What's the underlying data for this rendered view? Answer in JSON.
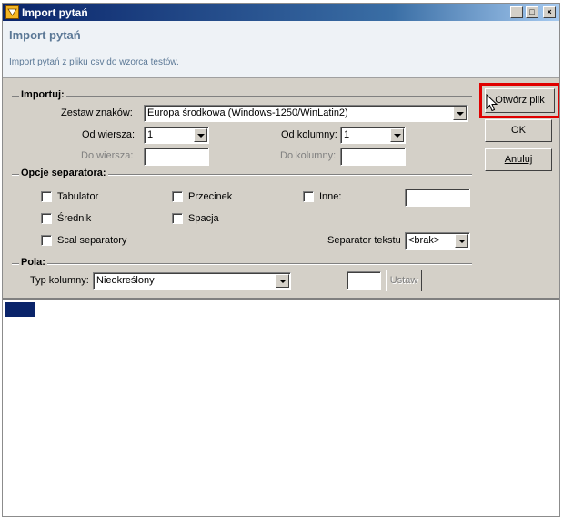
{
  "window": {
    "title": "Import pytań",
    "min": "_",
    "max": "□",
    "close": "×"
  },
  "header": {
    "title": "Import pytań",
    "description": "Import pytań z pliku csv do wzorca testów."
  },
  "import_group": {
    "label": "Importuj:",
    "charset_label": "Zestaw znaków:",
    "charset_value": "Europa środkowa (Windows-1250/WinLatin2)",
    "from_row_label": "Od wiersza:",
    "from_row_value": "1",
    "to_row_label": "Do wiersza:",
    "from_col_label": "Od kolumny:",
    "from_col_value": "1",
    "to_col_label": "Do kolumny:"
  },
  "separator_group": {
    "label": "Opcje separatora:",
    "tab": "Tabulator",
    "comma": "Przecinek",
    "other": "Inne:",
    "semicolon": "Średnik",
    "space": "Spacja",
    "merge": "Scal separatory",
    "text_sep_label": "Separator tekstu",
    "text_sep_value": "<brak>"
  },
  "fields_group": {
    "label": "Pola:",
    "col_type_label": "Typ kolumny:",
    "col_type_value": "Nieokreślony",
    "set_button": "Ustaw"
  },
  "buttons": {
    "open": "Otwórz plik",
    "ok": "OK",
    "cancel": "Anuluj"
  },
  "colors": {
    "title_start": "#0a246a",
    "title_end": "#a6caf0",
    "face": "#d4d0c8",
    "highlight": "#e00000",
    "header_text": "#5b7896"
  }
}
